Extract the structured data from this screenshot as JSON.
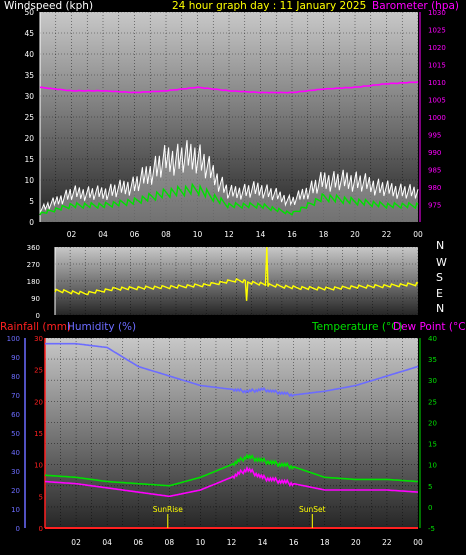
{
  "header": {
    "left": "Windspeed (kph)",
    "center": "24 hour graph day : 11 January 2025",
    "right": "Barometer (hpa)"
  },
  "compass": [
    "N",
    "W",
    "S",
    "E",
    "N"
  ],
  "lower_header": {
    "rainfall": "Rainfall (mm)",
    "humidity": "Humidity (%)",
    "temperature": "Temperature (°C)",
    "dewpoint": "Dew Point (°C)"
  },
  "markers": {
    "sunrise": "SunRise",
    "sunset": "SunSet"
  },
  "colors": {
    "wind_avg": "#00e000",
    "wind_gust": "#ffffff",
    "barometer": "#ff00ff",
    "direction": "#ffff00",
    "rainfall": "#ff2020",
    "humidity": "#6c6cff",
    "temperature": "#00e000",
    "dewpoint": "#ff00ff",
    "sun": "#ffff00"
  },
  "chart_data": [
    {
      "type": "line",
      "title": "24 hour graph day : 11 January 2025",
      "ylabel": "Windspeed (kph)",
      "y2label": "Barometer (hpa)",
      "ylim": [
        0,
        50
      ],
      "y2lim": [
        970,
        1030
      ],
      "yticks": [
        0,
        5,
        10,
        15,
        20,
        25,
        30,
        35,
        40,
        45,
        50
      ],
      "y2ticks": [
        975,
        980,
        985,
        990,
        995,
        1000,
        1005,
        1010,
        1015,
        1020,
        1025,
        1030
      ],
      "xlim": [
        0,
        24
      ],
      "xticks": [
        "02",
        "04",
        "06",
        "08",
        "10",
        "12",
        "14",
        "16",
        "18",
        "20",
        "22",
        "00"
      ],
      "hours": [
        0,
        2,
        4,
        6,
        8,
        10,
        12,
        14,
        16,
        18,
        20,
        22,
        24
      ],
      "series": [
        {
          "name": "Windspeed (kph)",
          "axis": "left",
          "values": [
            2,
            4,
            4,
            5,
            7,
            8,
            4,
            4,
            2,
            6,
            5,
            4,
            4
          ]
        },
        {
          "name": "Gust",
          "axis": "left",
          "values": [
            3,
            7,
            7,
            9,
            15,
            16,
            7,
            8,
            5,
            10,
            10,
            8,
            7
          ]
        },
        {
          "name": "Barometer (hpa)",
          "axis": "right",
          "values": [
            1008.5,
            1007.5,
            1007.5,
            1007,
            1007.5,
            1008.5,
            1007.5,
            1007,
            1007,
            1008,
            1008.5,
            1009.5,
            1010
          ]
        }
      ]
    },
    {
      "type": "line",
      "ylabel": "Wind Direction",
      "ylim": [
        0,
        360
      ],
      "yticks": [
        0,
        90,
        180,
        270,
        360
      ],
      "xlim": [
        0,
        24
      ],
      "hours": [
        0,
        2,
        4,
        6,
        8,
        10,
        12,
        14,
        16,
        18,
        20,
        22,
        24
      ],
      "series": [
        {
          "name": "Direction",
          "values": [
            130,
            115,
            140,
            145,
            150,
            160,
            185,
            160,
            145,
            140,
            150,
            155,
            165
          ]
        }
      ]
    },
    {
      "type": "line",
      "xlim": [
        0,
        24
      ],
      "xticks": [
        "02",
        "04",
        "06",
        "08",
        "10",
        "12",
        "14",
        "16",
        "18",
        "20",
        "22",
        "00"
      ],
      "hours": [
        0,
        2,
        4,
        6,
        8,
        10,
        12,
        13,
        14,
        16,
        18,
        20,
        22,
        24
      ],
      "axes": {
        "humidity": {
          "label": "Humidity (%)",
          "ylim": [
            0,
            100
          ],
          "yticks": [
            0,
            10,
            20,
            30,
            40,
            50,
            60,
            70,
            80,
            90,
            100
          ]
        },
        "rainfall": {
          "label": "Rainfall (mm)",
          "ylim": [
            0,
            30
          ],
          "yticks": [
            0,
            5,
            10,
            15,
            20,
            25,
            30
          ]
        },
        "temperature": {
          "label": "Temperature (°C)",
          "ylim": [
            -5,
            40
          ],
          "yticks": [
            -5,
            0,
            5,
            10,
            15,
            20,
            25,
            30,
            35,
            40
          ]
        }
      },
      "series": [
        {
          "name": "Humidity (%)",
          "axis": "humidity",
          "values": [
            97,
            97,
            95,
            85,
            80,
            75,
            73,
            72,
            73,
            70,
            72,
            75,
            80,
            85
          ]
        },
        {
          "name": "Temperature (°C)",
          "axis": "temperature",
          "values": [
            7.5,
            7,
            6,
            5.5,
            5,
            7,
            10,
            12,
            11,
            9.5,
            7,
            6.5,
            6.5,
            6
          ]
        },
        {
          "name": "Dew Point (°C)",
          "axis": "temperature",
          "values": [
            6,
            5.5,
            4.5,
            3.5,
            2.5,
            4,
            7,
            9,
            7,
            5.5,
            4,
            4,
            4,
            3.5
          ]
        },
        {
          "name": "Rainfall (mm)",
          "axis": "rainfall",
          "values": [
            0,
            0,
            0,
            0,
            0,
            0,
            0,
            0,
            0,
            0,
            0,
            0,
            0,
            0
          ]
        }
      ],
      "annotations": [
        {
          "text": "SunRise",
          "hour": 7.9
        },
        {
          "text": "SunSet",
          "hour": 17.2
        }
      ]
    }
  ]
}
